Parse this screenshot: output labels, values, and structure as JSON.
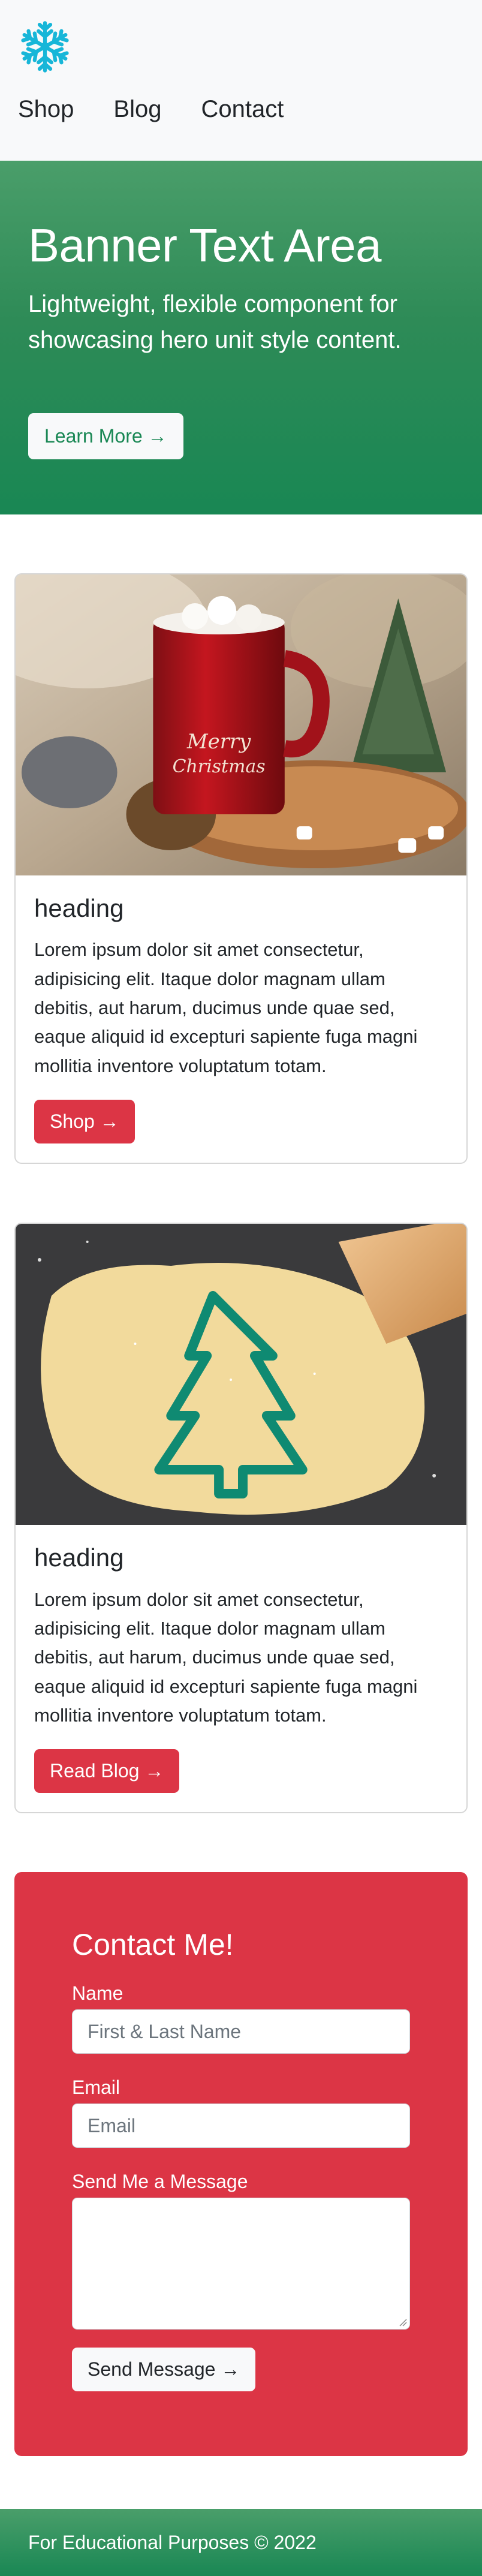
{
  "nav": {
    "logo_icon": "snowflake-icon",
    "logo_color": "#17b6d8",
    "links": [
      {
        "label": "Shop"
      },
      {
        "label": "Blog"
      },
      {
        "label": "Contact"
      }
    ]
  },
  "banner": {
    "title": "Banner Text Area",
    "subtitle": "Lightweight, flexible component for showcasing hero unit style content.",
    "button_label": "Learn More →",
    "color": "#198754"
  },
  "cards": [
    {
      "image": "christmas-mug-photo",
      "title": "heading",
      "text": "Lorem ipsum dolor sit amet consectetur, adipisicing elit. Itaque dolor magnam ullam debitis, aut harum, ducimus unde quae sed, eaque aliquid id excepturi sapiente fuga magni mollitia inventore voluptatum totam.",
      "button_label": "Shop →"
    },
    {
      "image": "cookie-dough-tree-cutter-photo",
      "title": "heading",
      "text": "Lorem ipsum dolor sit amet consectetur, adipisicing elit. Itaque dolor magnam ullam debitis, aut harum, ducimus unde quae sed, eaque aliquid id excepturi sapiente fuga magni mollitia inventore voluptatum totam.",
      "button_label": "Read Blog →"
    }
  ],
  "contact": {
    "title": "Contact Me!",
    "name_label": "Name",
    "name_placeholder": "First & Last Name",
    "email_label": "Email",
    "email_placeholder": "Email",
    "message_label": "Send Me a Message",
    "message_value": "",
    "submit_label": "Send Message →",
    "color": "#dc3545"
  },
  "footer": {
    "text": "For Educational Purposes © 2022"
  }
}
